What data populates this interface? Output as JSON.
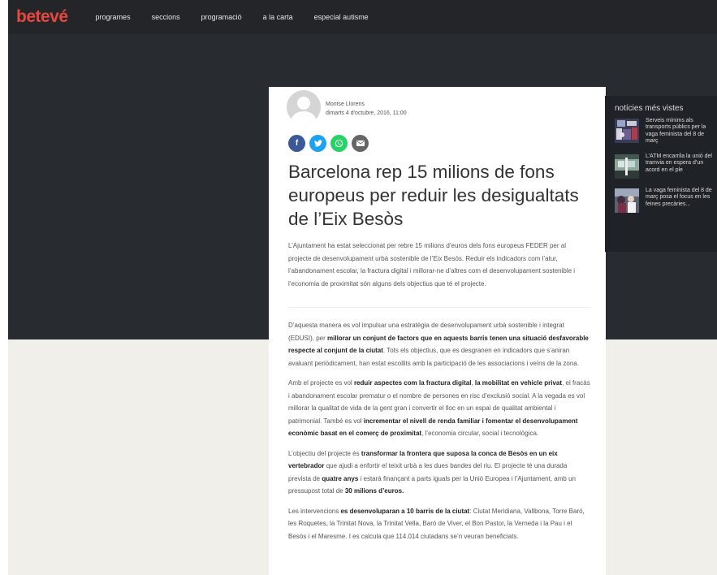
{
  "header": {
    "logo": "betevé",
    "nav": [
      "programes",
      "seccions",
      "programació",
      "a la carta",
      "especial autisme"
    ]
  },
  "article": {
    "author": "Montse Llorens",
    "date": "dimarts 4 d'octubre, 2016, 11:00",
    "share_icons": [
      "facebook-icon",
      "twitter-icon",
      "whatsapp-icon",
      "email-icon"
    ],
    "title": "Barcelona rep 15 milions de fons europeus per reduir les desigualtats de l’Eix Besòs",
    "lead": "L’Ajuntament ha estat seleccionat per rebre 15 milions d’euros dels fons europeus FEDER per al projecte de desenvolupament urbà sostenible de l’Eix Besòs. Reduir els indicadors com l’atur, l’abandonament escolar, la fractura digital i millorar-ne d’altres com el desenvolupament sostenible i l’economia de proximitat són alguns dels objectius que té el projecte.",
    "paragraphs": [
      [
        {
          "t": "D’aquesta manera es vol impulsar una estratègia de desenvolupament urbà sostenible i integrat (EDUSI), per "
        },
        {
          "t": "millorar un conjunt de factors que en aquests barris tenen una situació desfavorable respecte al conjunt de la ciutat",
          "b": true
        },
        {
          "t": ". Tots els objectius, que es desgranen en indicadors que s’aniran avaluant periòdicament, han estat escollits amb la participació de les associacions i veïns de la zona."
        }
      ],
      [
        {
          "t": "Amb el projecte es vol "
        },
        {
          "t": "reduir aspectes com la fractura digital",
          "b": true
        },
        {
          "t": ", "
        },
        {
          "t": "la mobilitat en vehicle privat",
          "b": true
        },
        {
          "t": ", el fracàs i abandonament escolar prematur o el nombre de persones en risc d’exclusió social. A la vegada es vol millorar la qualitat de vida de la gent gran i convertir el lloc en un espai de qualitat ambiental i patrimonial. També es vol "
        },
        {
          "t": "incrementar el nivell de renda familiar i fomentar el desenvolupament econòmic basat en el comerç de proximitat",
          "b": true
        },
        {
          "t": ", l’economia circular, social i tecnològica."
        }
      ],
      [
        {
          "t": "L’objectiu del projecte és "
        },
        {
          "t": "transformar la frontera que suposa la conca de Besòs en un eix vertebrador",
          "b": true
        },
        {
          "t": " que ajudi a enfortir el teixit urbà a les dues bandes del riu. El projecte té una durada prevista de "
        },
        {
          "t": "quatre anys",
          "b": true
        },
        {
          "t": " i estarà finançant a parts iguals per la Unió Europea i l’Ajuntament, amb un pressupost total de "
        },
        {
          "t": "30 milions d’euros.",
          "b": true
        }
      ],
      [
        {
          "t": "Les intervencions "
        },
        {
          "t": "es desenvoluparan a 10 barris de la ciutat",
          "b": true
        },
        {
          "t": ": Ciutat Meridiana, Vallbona, Torre Baró, les Roquetes, la Trinitat Nova, la Trinitat Vella, Baró de Viver, el Bon Pastor, la Verneda i la Pau i el Besòs i el Maresme. I es calcula que 114.014 ciutadans se’n veuran beneficiats."
        }
      ]
    ]
  },
  "sidebar": {
    "title": "notícies més vistes",
    "items": [
      {
        "text": "Serveis mínims als transports públics per la vaga feminista del 8 de març"
      },
      {
        "text": "L’ATM encarrila la unió del tramvia en espera d’un acord en el ple"
      },
      {
        "text": "La vaga feminista del 8 de març posa el focus en les feines precàries..."
      }
    ]
  },
  "colors": {
    "brand": "#e8473f",
    "facebook": "#3b5998",
    "twitter": "#1da1f2",
    "whatsapp": "#25d366",
    "email": "#666666"
  }
}
